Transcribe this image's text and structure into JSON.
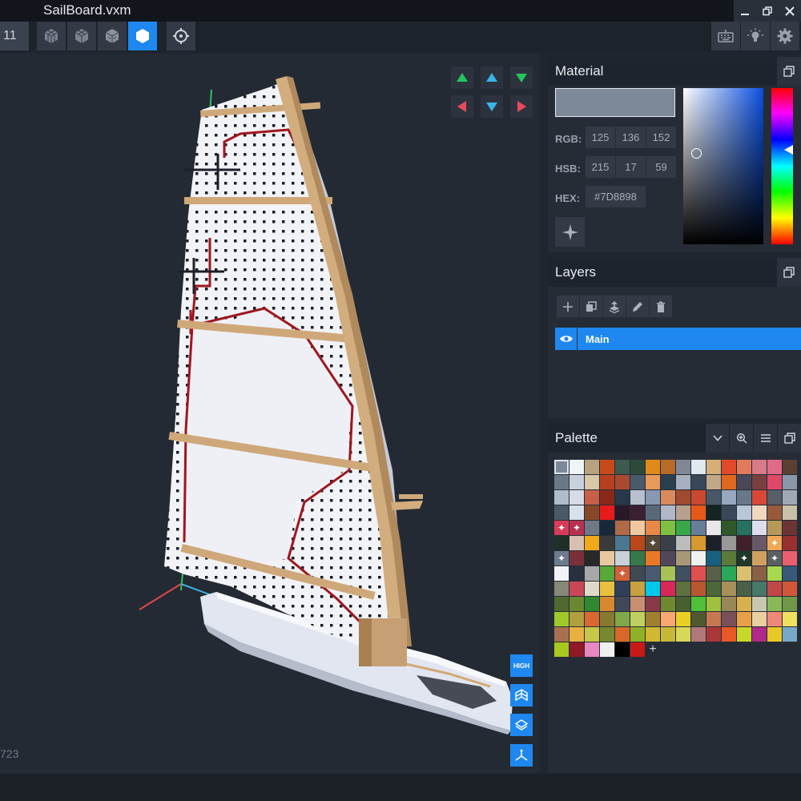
{
  "window": {
    "title": "SailBoard.vxm",
    "frame_fragment": "11"
  },
  "viewport": {
    "voxel_count_fragment": "723",
    "quality_label": "HIGH"
  },
  "material": {
    "title": "Material",
    "rgb_label": "RGB:",
    "rgb": [
      "125",
      "136",
      "152"
    ],
    "hsb_label": "HSB:",
    "hsb": [
      "215",
      "17",
      "59"
    ],
    "hex_label": "HEX:",
    "hex": "#7D8898",
    "current_color": "#7d8898"
  },
  "layers": {
    "title": "Layers",
    "items": [
      {
        "name": "Main",
        "visible": true
      }
    ]
  },
  "palette": {
    "title": "Palette",
    "colors": [
      "#7d8898",
      "#eef4f8",
      "#b8a37e",
      "#c84a1c",
      "#3e5a50",
      "#2d4a3a",
      "#e08a1a",
      "#b86a28",
      "#808898",
      "#e0e8f0",
      "#d4b078",
      "#e04a2a",
      "#e07a5a",
      "#d87a88",
      "#e06a88",
      "#5a4030",
      "#6a7888",
      "#c8d0dc",
      "#d8c8a8",
      "#b84020",
      "#a84a30",
      "#4a5a6a",
      "#e89a5a",
      "#2a4050",
      "#a8b0c0",
      "#384858",
      "#c0a888",
      "#e06820",
      "#4a4858",
      "#7a4040",
      "#e04868",
      "#8a98a8",
      "#b0bccc",
      "#d8dce8",
      "#c86048",
      "#882818",
      "#283848",
      "#b8c0d0",
      "#8898b0",
      "#d88a5a",
      "#a04a30",
      "#c84830",
      "#485868",
      "#98a8c0",
      "#687888",
      "#d84838",
      "#585e68",
      "#a0a8b8",
      "#4a5868",
      "#d8e0ec",
      "#884828",
      "#e81a1a",
      "#281828",
      "#3a2030",
      "#5a6878",
      "#b0b8c8",
      "#b8a090",
      "#e85818",
      "#142420",
      "#384858",
      "#b8c8d8",
      "#f0d8c0",
      "#985a3a",
      "#c8c0a8",
      "#d83a5a",
      "#b83050",
      "#707888",
      "#182838",
      "#b06a48",
      "#f0c8a0",
      "#e88848",
      "#80c040",
      "#38a848",
      "#687e98",
      "#e8e8e8",
      "#305828",
      "#287060",
      "#ddddee",
      "#b89858",
      "#6c3434",
      "#203028",
      "#d8c0b0",
      "#f0a818",
      "#3a3a3a",
      "#4a7890",
      "#b84818",
      "#584838",
      "#3a4048",
      "#bcbcbc",
      "#d89830",
      "#1c2028",
      "#989898",
      "#402028",
      "#685868",
      "#f0a858",
      "#983030",
      "#6c7c8c",
      "#7a3038",
      "#282828",
      "#e8c8a0",
      "#c8d0d8",
      "#387848",
      "#e87828",
      "#504858",
      "#a89878",
      "#f0f0f0",
      "#186080",
      "#5a7a3a",
      "#203828",
      "#d0a060",
      "#5a6060",
      "#e86070",
      "#f0f4f8",
      "#283040",
      "#a8a8a8",
      "#58a838",
      "#d06038",
      "#404850",
      "#4a5a70",
      "#a8c058",
      "#405060",
      "#e05050",
      "#586048",
      "#28a858",
      "#d8c070",
      "#886048",
      "#a8d850",
      "#385878",
      "#888878",
      "#c84858",
      "#e0d8c8",
      "#e8c040",
      "#304058",
      "#c8a040",
      "#00c8e8",
      "#d82858",
      "#607040",
      "#b85830",
      "#4a6838",
      "#a89058",
      "#4a6048",
      "#487868",
      "#c04848",
      "#d05838",
      "#506830",
      "#6a8830",
      "#308830",
      "#d88830",
      "#404858",
      "#c89070",
      "#883848",
      "#708830",
      "#486030",
      "#50c038",
      "#a0c040",
      "#988858",
      "#d8b050",
      "#c8c8b0",
      "#88b858",
      "#709848",
      "#a0c828",
      "#b0a040",
      "#d86830",
      "#887830",
      "#80a848",
      "#c0d060",
      "#a08030",
      "#f8a870",
      "#e8d028",
      "#505830",
      "#c87850",
      "#7a5058",
      "#e8a048",
      "#e8d0a0",
      "#f08878",
      "#f0e060",
      "#a87050",
      "#e8b040",
      "#c8c848",
      "#788830",
      "#d86828",
      "#90b028",
      "#d0b830",
      "#c8b838",
      "#d8d858",
      "#b07878",
      "#a83838",
      "#e85828",
      "#c8d828",
      "#b02888",
      "#e8c828",
      "#78a8c8",
      "#a8c820",
      "#901828",
      "#e888c0",
      "#f0f0f0",
      "#000000",
      "#c81818"
    ]
  }
}
